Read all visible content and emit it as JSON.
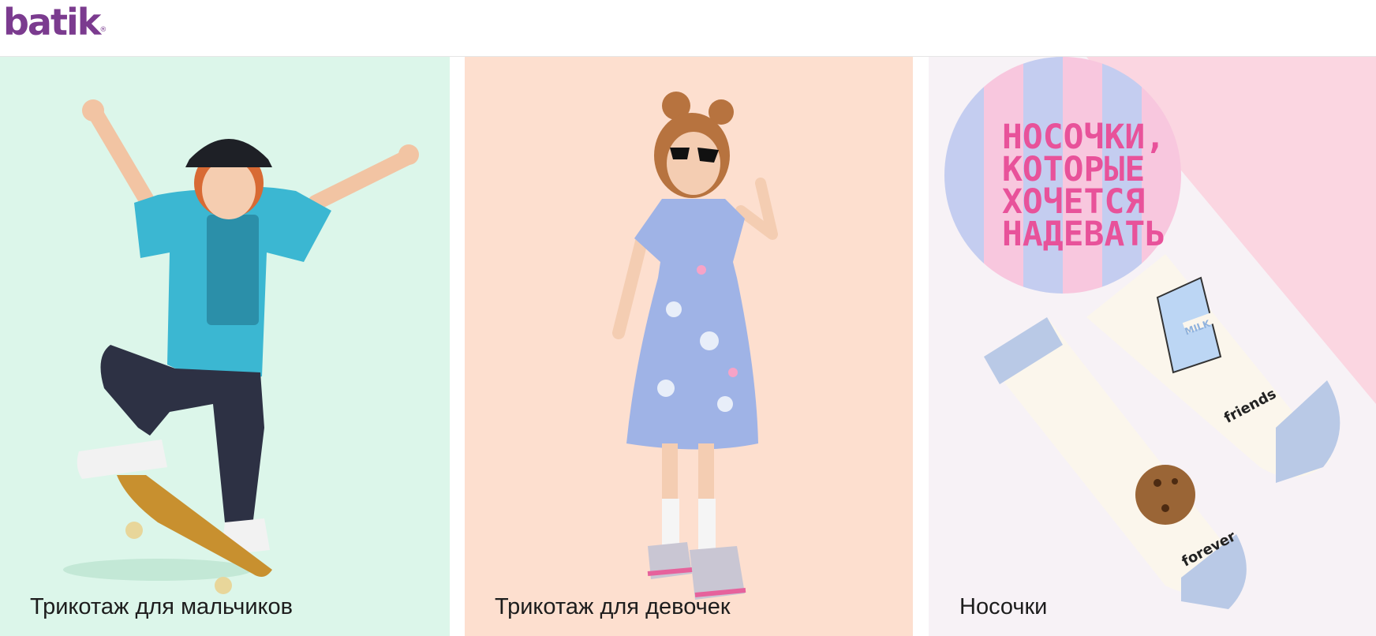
{
  "header": {
    "logo_text": "batik",
    "logo_mark": "®"
  },
  "categories": [
    {
      "label": "Трикотаж для мальчиков",
      "background": "#dcf6ea",
      "photo": "boy-on-skateboard"
    },
    {
      "label": "Трикотаж для девочек",
      "background": "#fddfcf",
      "photo": "girl-in-dress"
    },
    {
      "label": "Носочки",
      "background": "#f7f2f6",
      "photo": "socks-milk-cookie"
    }
  ],
  "promo": {
    "text": "НОСОЧКИ,\nКОТОРЫЕ\nХОЧЕТСЯ\nНАДЕВАТЬ"
  },
  "sock_prints": {
    "milk": "MILK",
    "friends": "friends",
    "forever": "forever"
  },
  "colors": {
    "brand": "#7b3b8f",
    "promo_pink": "#e8529a"
  }
}
